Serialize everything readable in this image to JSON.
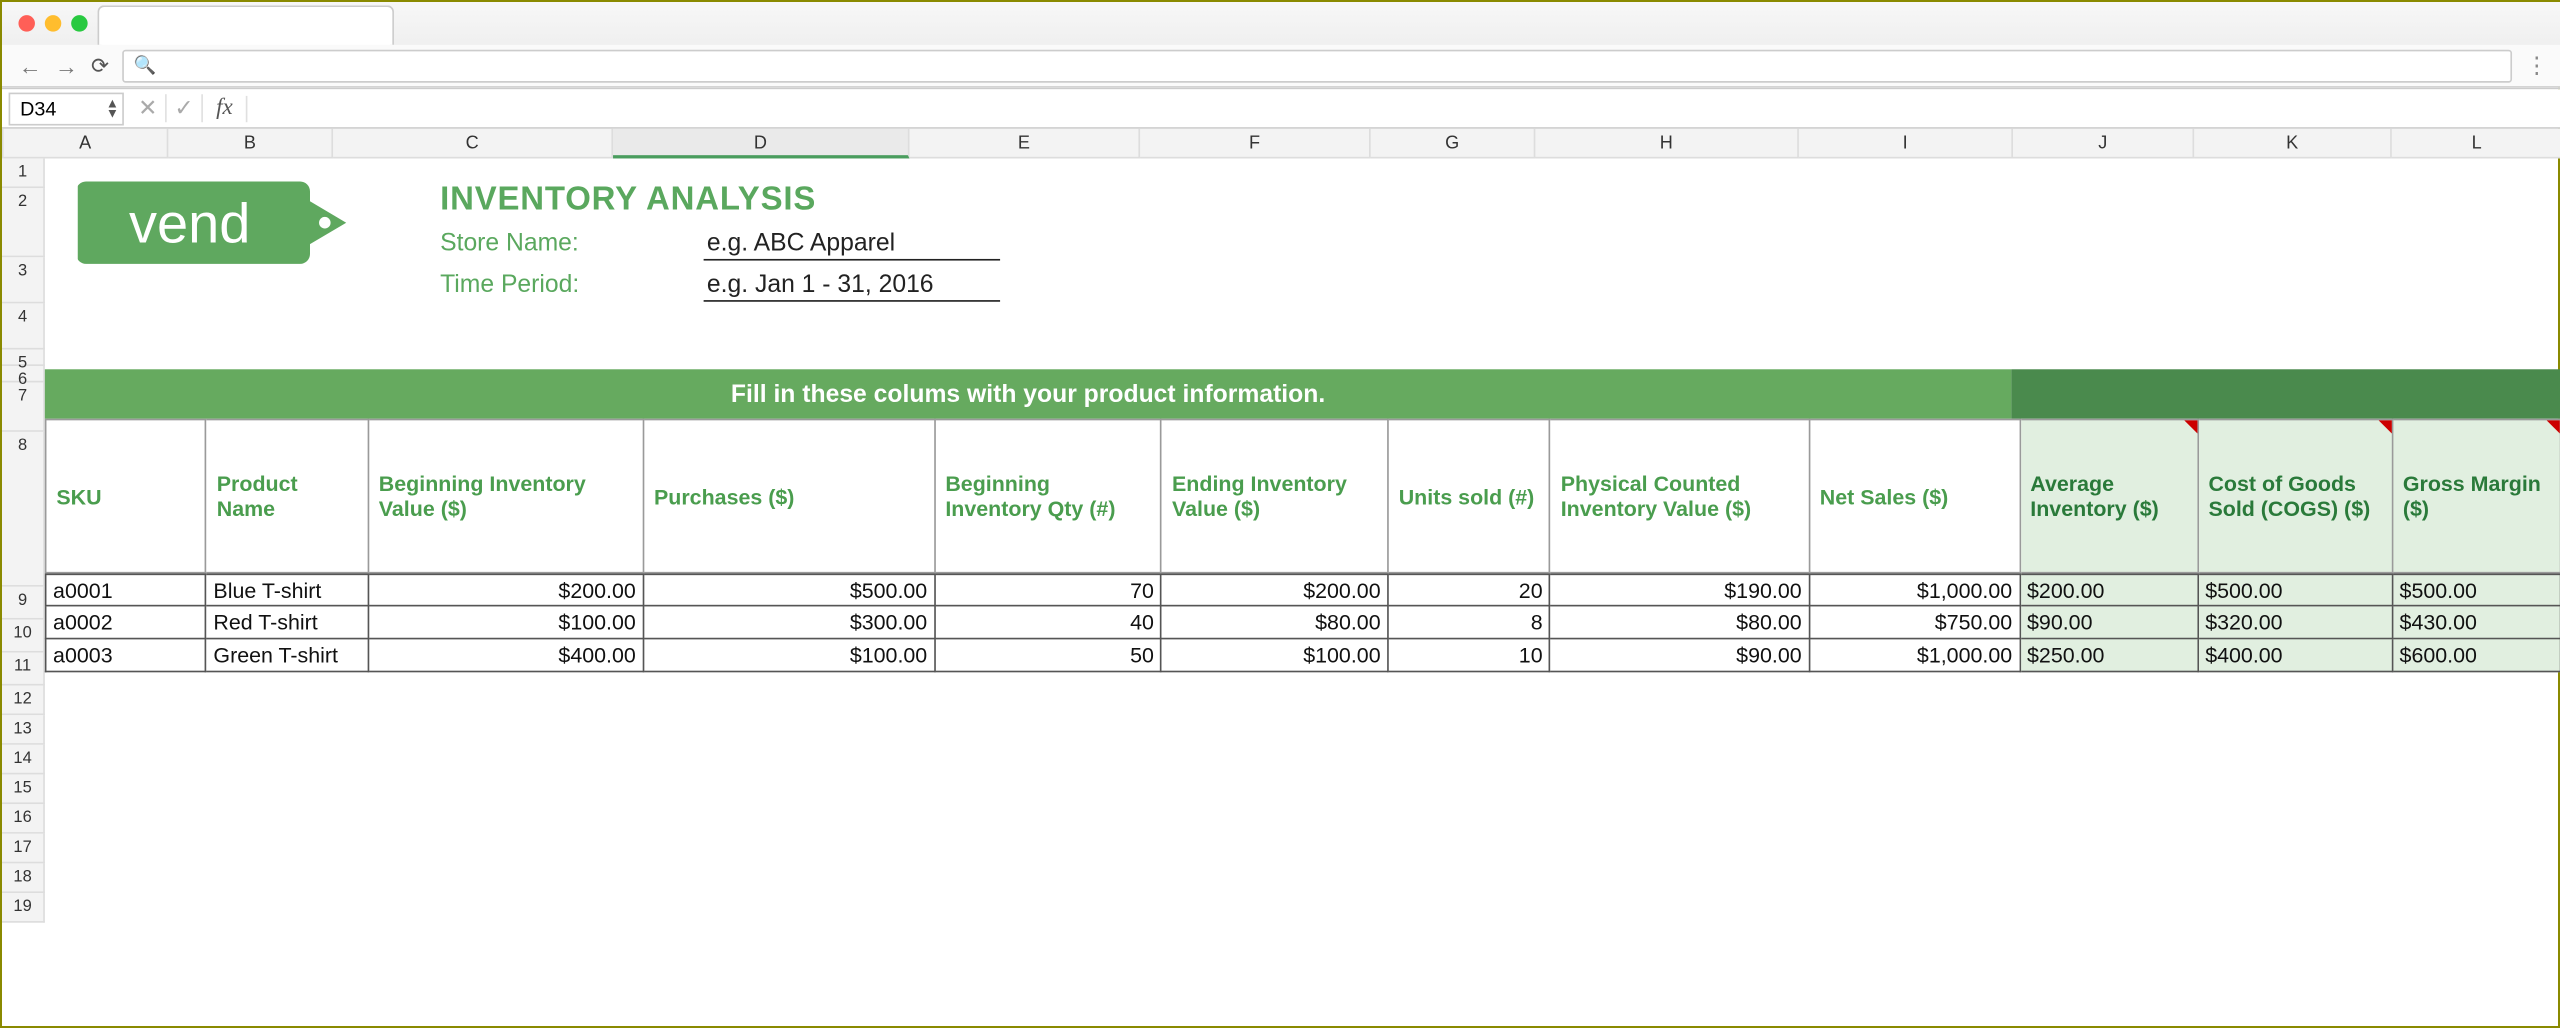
{
  "browser": {
    "url_hint": ""
  },
  "formula_bar": {
    "cell_ref": "D34",
    "fx_label": "fx",
    "formula": ""
  },
  "columns": [
    "A",
    "B",
    "C",
    "D",
    "E",
    "F",
    "G",
    "H",
    "I",
    "J",
    "K",
    "L"
  ],
  "row_numbers": [
    "1",
    "2",
    "3",
    "4",
    "5",
    "6",
    "7",
    "8",
    "9",
    "10",
    "11",
    "12",
    "13",
    "14",
    "15",
    "16",
    "17",
    "18",
    "19"
  ],
  "branding": {
    "logo_text": "vend"
  },
  "header": {
    "title": "INVENTORY ANALYSIS",
    "store_label": "Store Name:",
    "store_value": "e.g. ABC Apparel",
    "period_label": "Time Period:",
    "period_value": "e.g. Jan 1 - 31, 2016"
  },
  "banner": {
    "text": "Fill in these colums with your product information."
  },
  "table": {
    "headers": [
      "SKU",
      "Product Name",
      "Beginning Inventory Value ($)",
      "Purchases ($)",
      "Beginning Inventory Qty (#)",
      "Ending Inventory Value ($)",
      "Units sold (#)",
      "Physical Counted Inventory Value ($)",
      "Net Sales ($)",
      "Average Inventory ($)",
      "Cost of Goods Sold (COGS) ($)",
      "Gross Margin ($)"
    ],
    "rows": [
      {
        "sku": "a0001",
        "name": "Blue T-shirt",
        "begin_val": "$200.00",
        "purchases": "$500.00",
        "begin_qty": "70",
        "end_val": "$200.00",
        "units_sold": "20",
        "phys_val": "$190.00",
        "net_sales": "$1,000.00",
        "avg_inv": "$200.00",
        "cogs": "$500.00",
        "margin": "$500.00"
      },
      {
        "sku": "a0002",
        "name": "Red T-shirt",
        "begin_val": "$100.00",
        "purchases": "$300.00",
        "begin_qty": "40",
        "end_val": "$80.00",
        "units_sold": "8",
        "phys_val": "$80.00",
        "net_sales": "$750.00",
        "avg_inv": "$90.00",
        "cogs": "$320.00",
        "margin": "$430.00"
      },
      {
        "sku": "a0003",
        "name": "Green T-shirt",
        "begin_val": "$400.00",
        "purchases": "$100.00",
        "begin_qty": "50",
        "end_val": "$100.00",
        "units_sold": "10",
        "phys_val": "$90.00",
        "net_sales": "$1,000.00",
        "avg_inv": "$250.00",
        "cogs": "$400.00",
        "margin": "$600.00"
      }
    ]
  }
}
